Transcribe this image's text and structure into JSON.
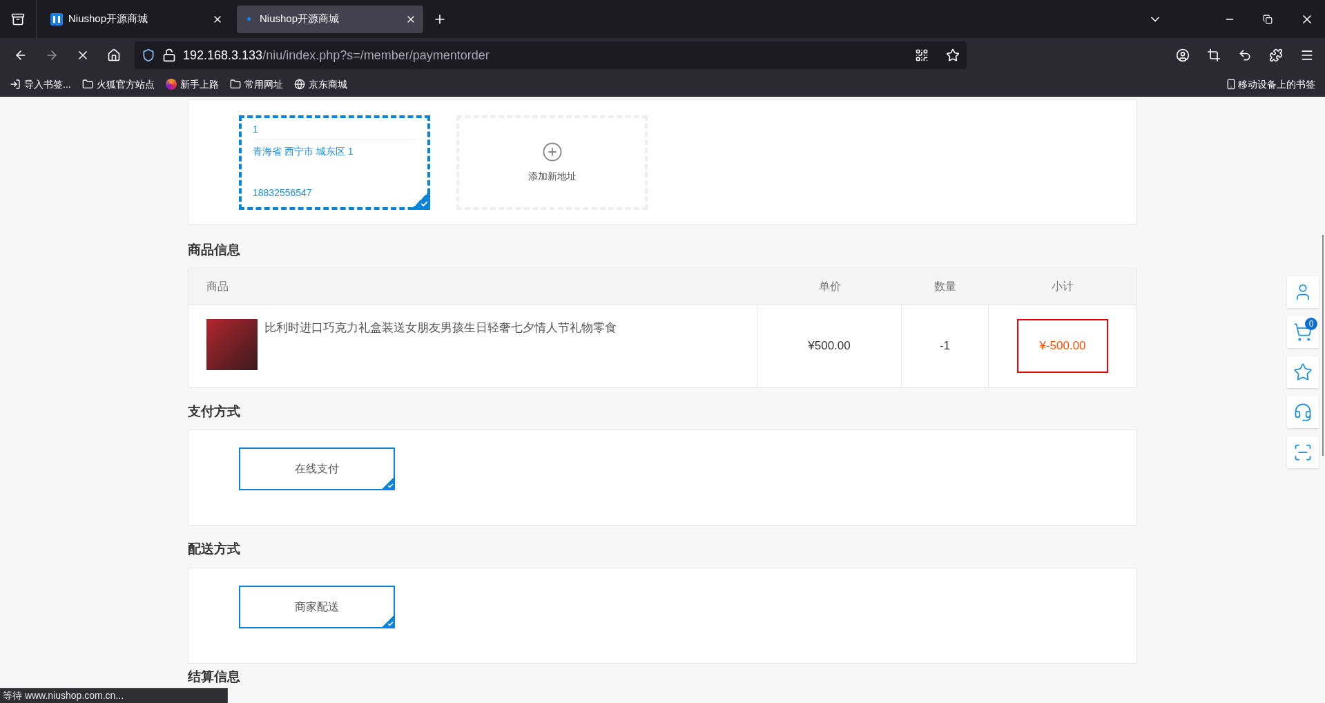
{
  "browser": {
    "tabs": [
      {
        "title": "Niushop开源商城",
        "selected": false,
        "loading": false
      },
      {
        "title": "Niushop开源商城",
        "selected": true,
        "loading": true
      }
    ],
    "url_host": "192.168.3.133",
    "url_path": "/niu/index.php?s=/member/paymentorder",
    "bookmarks": [
      {
        "label": "导入书签...",
        "kind": "import"
      },
      {
        "label": "火狐官方站点",
        "kind": "folder"
      },
      {
        "label": "新手上路",
        "kind": "firefox"
      },
      {
        "label": "常用网址",
        "kind": "folder"
      },
      {
        "label": "京东商城",
        "kind": "globe"
      }
    ],
    "mobile_bookmarks": "移动设备上的书签"
  },
  "addresses": [
    {
      "name": "1",
      "address": "青海省 西宁市 城东区 1",
      "phone": "18832556547",
      "selected": true
    }
  ],
  "add_address": "添加新地址",
  "goods": {
    "title": "商品信息",
    "columns": [
      "商品",
      "单价",
      "数量",
      "小计"
    ],
    "rows": [
      {
        "name": "比利时进口巧克力礼盒装送女朋友男孩生日轻奢七夕情人节礼物零食",
        "price": "¥500.00",
        "quantity": "-1",
        "subtotal": "¥-500.00",
        "highlighted": true
      }
    ]
  },
  "payment": {
    "title": "支付方式",
    "options": [
      {
        "label": "在线支付",
        "selected": true
      }
    ]
  },
  "delivery": {
    "title": "配送方式",
    "options": [
      {
        "label": "商家配送",
        "selected": true
      }
    ]
  },
  "settlement": {
    "title": "结算信息"
  },
  "sidebar": {
    "cart_count": "0"
  },
  "status_text": "等待 www.niushop.com.cn..."
}
